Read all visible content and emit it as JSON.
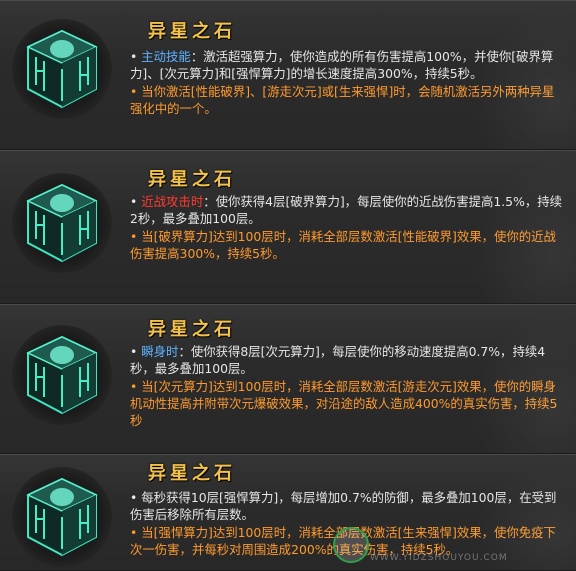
{
  "watermark": "WWW.YIDZSHOUYOU.COM",
  "icon_name": "alien-star-stone-icon",
  "accent_colors": {
    "title": "#f2c24a",
    "keyword_blue": "#5fb3ff",
    "keyword_red": "#ff3b30",
    "effect_orange": "#ff9a2e"
  },
  "cards": [
    {
      "title": "异星之石",
      "line1_bullet": "•",
      "line1_keyword": "主动技能",
      "line1_text": "：激活超强算力，使你造成的所有伤害提高100%，并使你[破界算力]、[次元算力]和[强悍算力]的增长速度提高300%，持续5秒。",
      "line2": "• 当你激活[性能破界]、[游走次元]或[生来强悍]时，会随机激活另外两种异星强化中的一个。"
    },
    {
      "title": "异星之石",
      "line1_bullet": "•",
      "line1_keyword": "近战攻击时",
      "line1_text": "：使你获得4层[破界算力]，每层使你的近战伤害提高1.5%，持续2秒，最多叠加100层。",
      "line2": "• 当[破界算力]达到100层时，消耗全部层数激活[性能破界]效果，使你的近战伤害提高300%，持续5秒。"
    },
    {
      "title": "异星之石",
      "line1_bullet": "•",
      "line1_keyword": "瞬身时",
      "line1_text": "：使你获得8层[次元算力]，每层使你的移动速度提高0.7%，持续4秒，最多叠加100层。",
      "line2": "• 当[次元算力]达到100层时，消耗全部层数激活[游走次元]效果，使你的瞬身机动性提高并附带次元爆破效果，对沿途的敌人造成400%的真实伤害，持续5秒"
    },
    {
      "title": "异星之石",
      "line1_bullet": "•",
      "line1_keyword": "",
      "line1_text": "每秒获得10层[强悍算力]，每层增加0.7%的防御，最多叠加100层，在受到伤害后移除所有层数。",
      "line2": "• 当[强悍算力]达到100层时，消耗全部层数激活[生来强悍]效果，使你免疫下次一伤害，并每秒对周围造成200%的真实伤害，持续5秒。"
    }
  ]
}
